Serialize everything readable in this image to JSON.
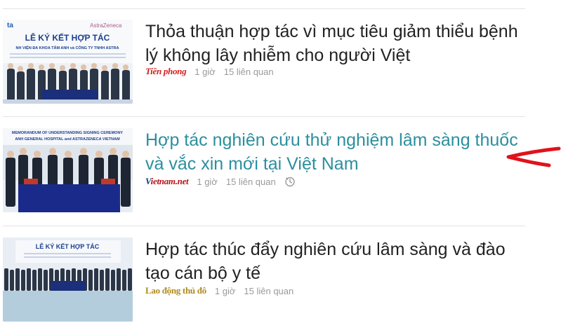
{
  "articles": [
    {
      "title": "Thỏa thuận hợp tác vì mục tiêu giảm thiểu bệnh lý không lây nhiễm cho người Việt",
      "source": "Tiền phong",
      "time": "1 giờ",
      "related": "15 liên quan",
      "thumb_banner": "LỄ KÝ KẾT HỢP TÁC",
      "thumb_sub": "NH VIỆN ĐA KHOA TÂM ANH và CÔNG TY TNHH ASTRA",
      "thumb_brand_left": "ta",
      "thumb_brand_right": "AstraZeneca",
      "active": false
    },
    {
      "title": "Hợp tác nghiên cứu thử nghiệm lâm sàng thuốc và vắc xin mới tại Việt Nam",
      "source_lead": "V",
      "source_rest": "ietnam.net",
      "time": "1 giờ",
      "related": "15 liên quan",
      "thumb_banner": "MEMORANDUM OF UNDERSTANDING SIGNING CEREMONY",
      "thumb_sub": "ANH GENERAL HOSPITAL and ASTRAZENECA VIETNAM",
      "active": true
    },
    {
      "title": "Hợp tác thúc đẩy nghiên cứu lâm sàng và đào tạo cán bộ y tế",
      "source": "Lao động thủ đô",
      "time": "1 giờ",
      "related": "15 liên quan",
      "thumb_banner": "LỄ KÝ KẾT HỢP TÁC",
      "active": false
    }
  ],
  "colors": {
    "active_title": "#2c8f9e",
    "annotation_arrow": "#e0121b"
  },
  "icons": [
    "history-icon",
    "annotation-arrow"
  ]
}
